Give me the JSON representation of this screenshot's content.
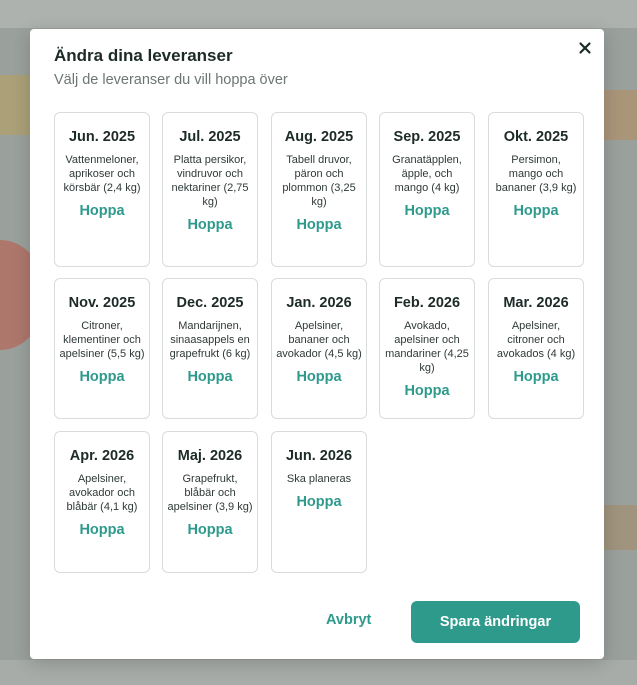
{
  "dialog": {
    "title": "Ändra dina leveranser",
    "subtitle": "Välj de leveranser du vill hoppa över",
    "close_icon": "close-icon"
  },
  "deliveries": [
    {
      "month": "Jun. 2025",
      "fruits": "Vattenmeloner, aprikoser och körsbär (2,4 kg)",
      "action": "Hoppa"
    },
    {
      "month": "Jul. 2025",
      "fruits": "Platta persikor, vindruvor och nektariner (2,75 kg)",
      "action": "Hoppa"
    },
    {
      "month": "Aug. 2025",
      "fruits": "Tabell druvor, päron och plommon (3,25 kg)",
      "action": "Hoppa"
    },
    {
      "month": "Sep. 2025",
      "fruits": "Granatäpplen, äpple, och mango (4 kg)",
      "action": "Hoppa"
    },
    {
      "month": "Okt. 2025",
      "fruits": "Persimon, mango och bananer (3,9 kg)",
      "action": "Hoppa"
    },
    {
      "month": "Nov. 2025",
      "fruits": "Citroner, klementiner och apelsiner (5,5 kg)",
      "action": "Hoppa"
    },
    {
      "month": "Dec. 2025",
      "fruits": "Mandarijnen, sinaasappels en grapefrukt (6 kg)",
      "action": "Hoppa"
    },
    {
      "month": "Jan. 2026",
      "fruits": "Apelsiner, bananer och avokador (4,5 kg)",
      "action": "Hoppa"
    },
    {
      "month": "Feb. 2026",
      "fruits": "Avokado, apelsiner och mandariner (4,25 kg)",
      "action": "Hoppa"
    },
    {
      "month": "Mar. 2026",
      "fruits": "Apelsiner, citroner och avokados (4 kg)",
      "action": "Hoppa"
    },
    {
      "month": "Apr. 2026",
      "fruits": "Apelsiner, avokador och blåbär (4,1 kg)",
      "action": "Hoppa"
    },
    {
      "month": "Maj. 2026",
      "fruits": "Grapefrukt, blåbär och apelsiner (3,9 kg)",
      "action": "Hoppa"
    },
    {
      "month": "Jun. 2026",
      "fruits": "Ska planeras",
      "action": "Hoppa"
    }
  ],
  "footer": {
    "cancel_label": "Avbryt",
    "save_label": "Spara ändringar"
  },
  "colors": {
    "accent": "#2e9a8c",
    "text_dark": "#1d2b28",
    "text_muted": "#6c7674",
    "card_border": "#d8dcdb"
  }
}
